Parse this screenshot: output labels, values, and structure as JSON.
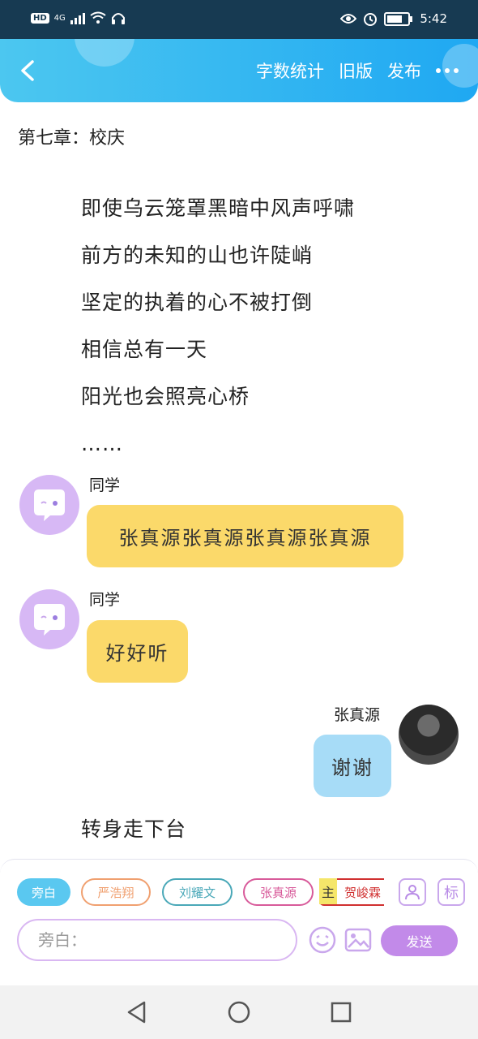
{
  "status_bar": {
    "network": "4G",
    "time": "5:42"
  },
  "header": {
    "actions": [
      "字数统计",
      "旧版",
      "发布"
    ],
    "accent_color": "#1fa8f2"
  },
  "chapter_title": "第七章：校庆",
  "lyrics": [
    "即使乌云笼罩黑暗中风声呼啸",
    "前方的未知的山也许陡峭",
    "坚定的执着的心不被打倒",
    "相信总有一天",
    "阳光也会照亮心桥",
    "……"
  ],
  "messages": [
    {
      "speaker": "同学",
      "text": "张真源张真源张真源张真源",
      "avatar": "chat-bubble-icon",
      "color": "#fbd96a"
    },
    {
      "speaker": "同学",
      "text": "好好听",
      "avatar": "chat-bubble-icon",
      "color": "#fbd96a"
    },
    {
      "speaker": "张真源",
      "text": "谢谢",
      "avatar": "photo",
      "color": "#a7dcf7"
    }
  ],
  "narration": "转身走下台",
  "role_chips": [
    {
      "label": "旁白",
      "selected": true,
      "color": "#5ac8f0"
    },
    {
      "label": "严浩翔",
      "color": "#f0a070"
    },
    {
      "label": "刘耀文",
      "color": "#4aa8b8"
    },
    {
      "label": "张真源",
      "color": "#d85a9a"
    },
    {
      "label": "贺峻霖",
      "color": "#d03030",
      "tag": "主"
    }
  ],
  "input": {
    "placeholder": "旁白："
  },
  "send_label": "发送",
  "mark_label": "标"
}
